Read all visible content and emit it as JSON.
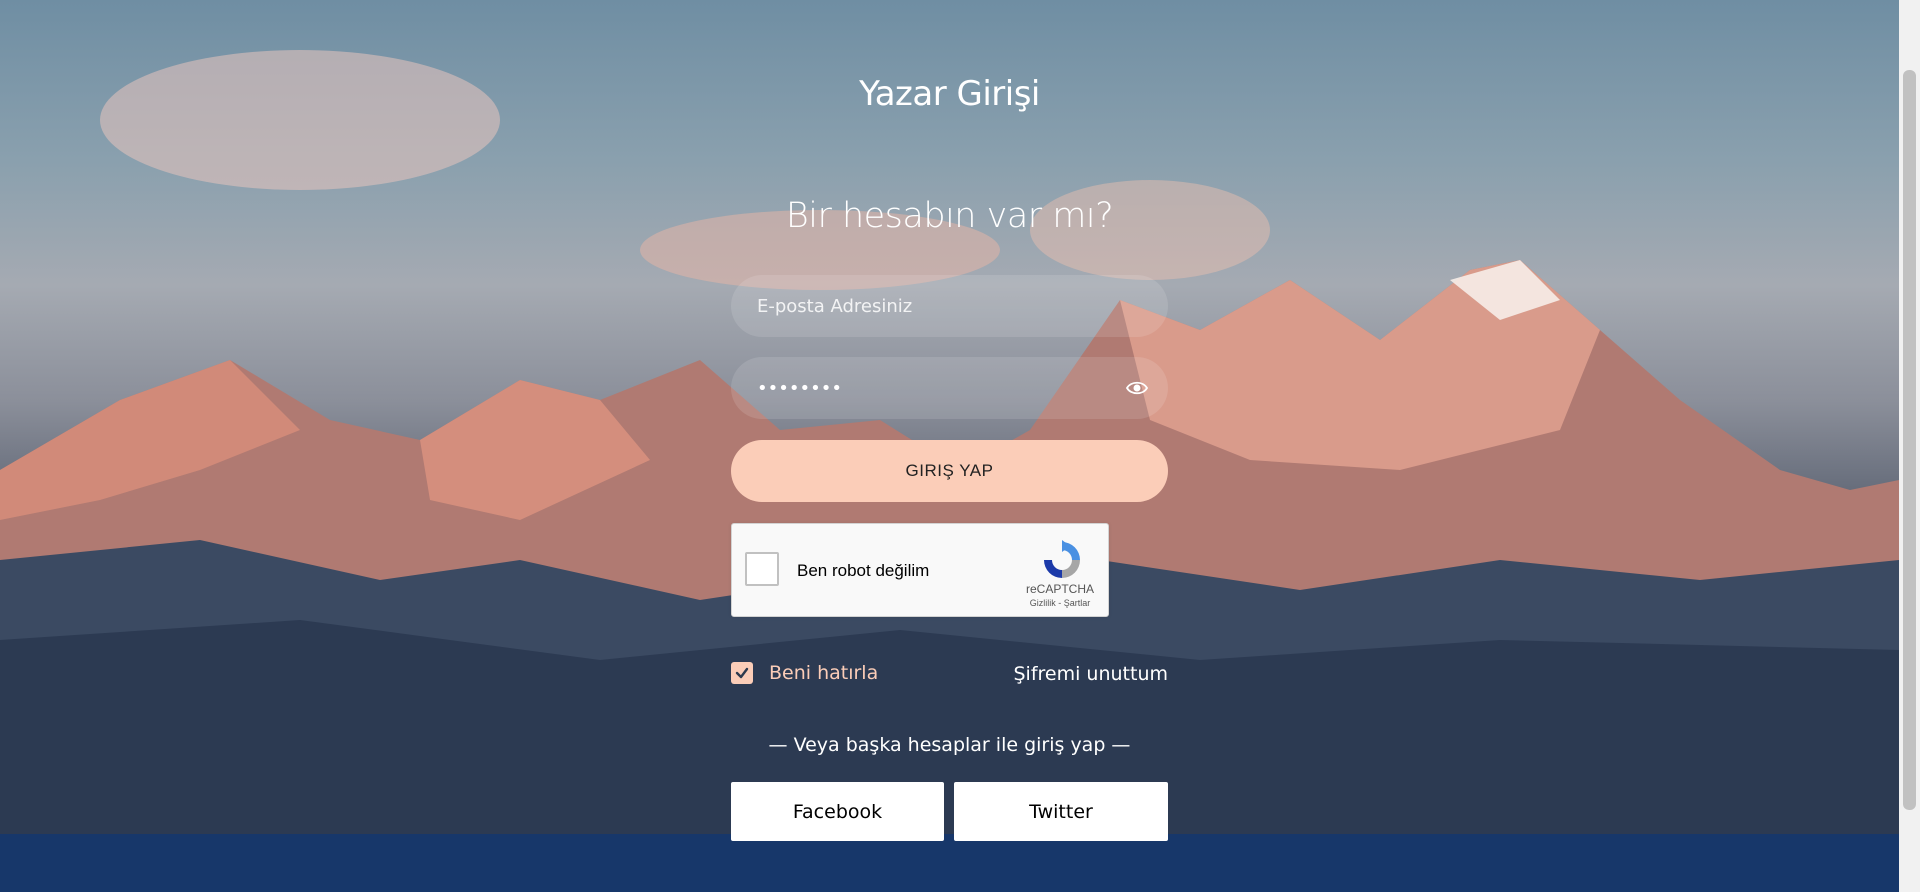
{
  "page": {
    "title": "Yazar Girişi",
    "heading": "Bir hesabın var mı?"
  },
  "form": {
    "email_placeholder": "E-posta Adresiniz",
    "password_value": "********",
    "login_label": "GIRIŞ YAP"
  },
  "captcha": {
    "label": "Ben robot değilim",
    "brand": "reCAPTCHA",
    "links": "Gizlilik - Şartlar",
    "checked": false
  },
  "options": {
    "remember_label": "Beni hatırla",
    "remember_checked": true,
    "forgot_label": "Şifremi unuttum"
  },
  "social": {
    "divider": "— Veya başka hesaplar ile giriş yap —",
    "facebook_label": "Facebook",
    "twitter_label": "Twitter"
  },
  "colors": {
    "accent": "#fbcdb8",
    "footer": "#17376a"
  },
  "icons": {
    "password_toggle": "eye-icon",
    "remember": "check-icon",
    "captcha": "recaptcha-logo-icon"
  }
}
